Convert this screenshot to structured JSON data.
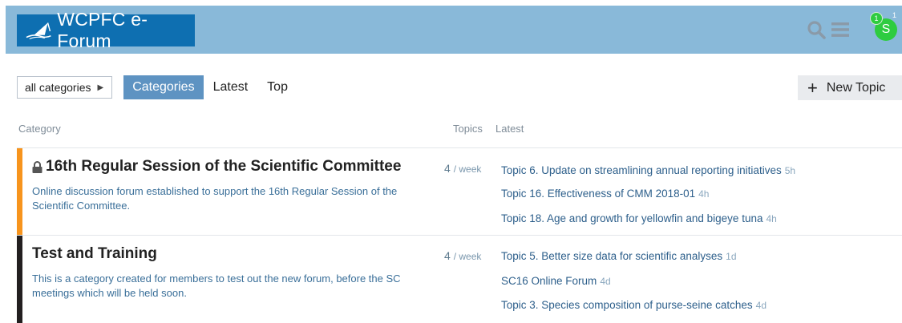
{
  "header": {
    "logo_text": "WCPFC e-Forum",
    "avatar_letter": "S",
    "notification_count": "1",
    "second_badge": "1",
    "colors": {
      "header_bg": "#89b9d9",
      "logo_bg": "#0e6fb1",
      "avatar": "#2ecc40"
    },
    "icons": [
      "search-icon",
      "hamburger-menu-icon"
    ]
  },
  "nav": {
    "dropdown_label": "all categories",
    "tabs": [
      {
        "label": "Categories",
        "active": true
      },
      {
        "label": "Latest",
        "active": false
      },
      {
        "label": "Top",
        "active": false
      }
    ],
    "new_topic_label": "New Topic"
  },
  "table": {
    "headers": {
      "category": "Category",
      "topics": "Topics",
      "latest": "Latest"
    },
    "rows": [
      {
        "name": "16th Regular Session of the Scientific Committee",
        "locked": true,
        "color": "#f7941d",
        "description": "Online discussion forum established to support the 16th Regular Session of the Scientific Committee.",
        "rate": "4",
        "rate_unit": "/ week",
        "topics": [
          {
            "title": "Topic 6. Update on streamlining annual reporting initiatives",
            "age": "5h"
          },
          {
            "title": "Topic 16. Effectiveness of CMM 2018-01",
            "age": "4h"
          },
          {
            "title": "Topic 18. Age and growth for yellowfin and bigeye tuna",
            "age": "4h"
          }
        ]
      },
      {
        "name": "Test and Training",
        "locked": false,
        "color": "#231f20",
        "description": "This is a category created for members to test out the new forum, before the SC meetings which will be held soon.",
        "rate": "4",
        "rate_unit": "/ week",
        "topics": [
          {
            "title": "Topic 5. Better size data for scientific analyses",
            "age": "1d"
          },
          {
            "title": "SC16 Online Forum",
            "age": "4d"
          },
          {
            "title": "Topic 3. Species composition of purse-seine catches",
            "age": "4d"
          }
        ]
      }
    ]
  }
}
